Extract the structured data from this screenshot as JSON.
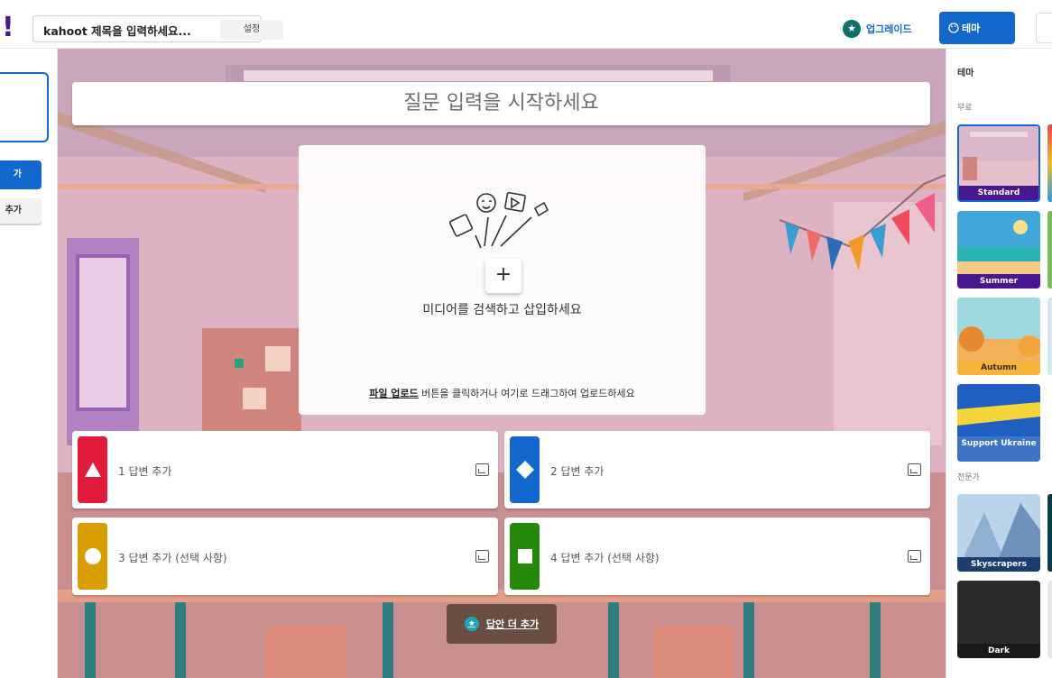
{
  "header": {
    "logo": "!",
    "title": "kahoot 제목을 입력하세요...",
    "settings_label": "설정",
    "upgrade_label": "업그레이드",
    "theme_label": "테마"
  },
  "left_sidebar": {
    "add_label": "가",
    "add_bank_label": "추가"
  },
  "question": {
    "placeholder": "질문 입력을 시작하세요"
  },
  "media": {
    "add_symbol": "+",
    "label": "미디어를 검색하고 삽입하세요",
    "upload_link": "파일 업로드",
    "upload_rest": " 버튼을 클릭하거나 여기로 드래그하여 업로드하세요"
  },
  "answers": [
    {
      "label": "1 답변 추가",
      "color": "#e21b3c",
      "shape": "triangle"
    },
    {
      "label": "2 답변 추가",
      "color": "#1368ce",
      "shape": "diamond"
    },
    {
      "label": "3 답변 추가 (선택 사항)",
      "color": "#d89e00",
      "shape": "circle"
    },
    {
      "label": "4 답변 추가 (선택 사항)",
      "color": "#26890c",
      "shape": "square"
    }
  ],
  "more_answers": {
    "label": "답안 더 추가"
  },
  "theme_panel": {
    "heading": "테마",
    "free_label": "무료",
    "pro_label": "전문가",
    "themes": [
      {
        "name": "Standard",
        "selected": true
      },
      {
        "name": "Summer",
        "selected": false
      },
      {
        "name": "Autumn",
        "selected": false
      },
      {
        "name": "Support Ukraine",
        "selected": false
      },
      {
        "name": "Skyscrapers",
        "selected": false
      },
      {
        "name": "Dark",
        "selected": false
      }
    ]
  },
  "colors": {
    "brand_purple": "#46178f",
    "primary_blue": "#1368ce",
    "answer_red": "#e21b3c",
    "answer_blue": "#1368ce",
    "answer_yellow": "#d89e00",
    "answer_green": "#26890c"
  }
}
